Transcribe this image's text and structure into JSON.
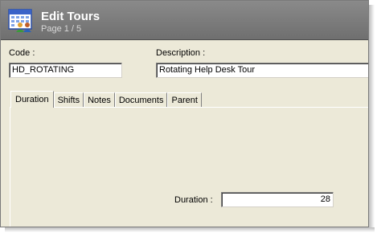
{
  "window": {
    "title": "Edit Tours",
    "subtitle": "Page 1 / 5",
    "icon": "calendar-people-icon"
  },
  "form": {
    "code_label": "Code :",
    "code_value": "HD_ROTATING",
    "description_label": "Description :",
    "description_value": "Rotating Help Desk Tour"
  },
  "tabs": [
    {
      "label": "Duration",
      "active": true
    },
    {
      "label": "Shifts",
      "active": false
    },
    {
      "label": "Notes",
      "active": false
    },
    {
      "label": "Documents",
      "active": false
    },
    {
      "label": "Parent",
      "active": false
    }
  ],
  "duration_tab": {
    "duration_label": "Duration :",
    "duration_value": "28"
  },
  "colors": {
    "titlebar": "#7a7a7a",
    "panel": "#ece9d8"
  }
}
